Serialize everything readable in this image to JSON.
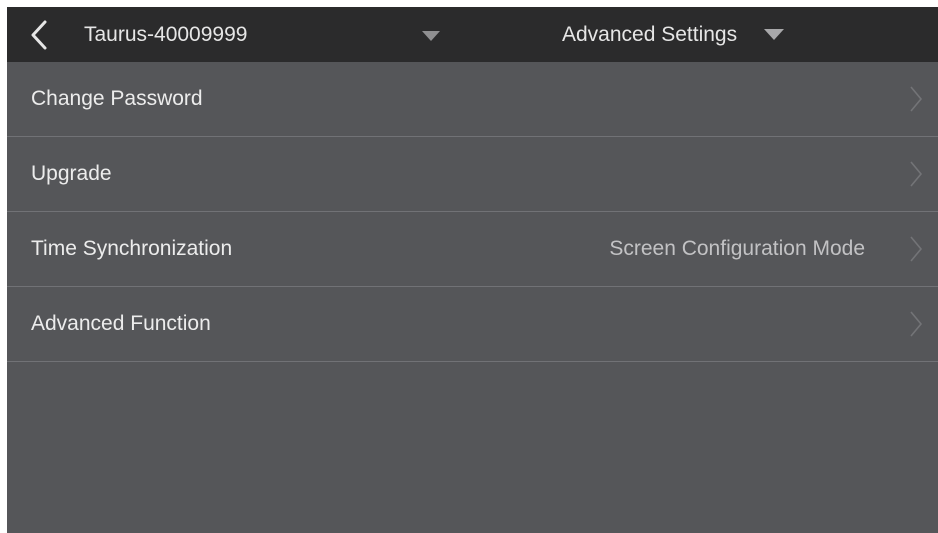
{
  "topbar": {
    "back_icon": "chevron-left-icon",
    "device_name": "Taurus-40009999",
    "device_dropdown_icon": "caret-down-icon",
    "title": "Advanced Settings",
    "title_dropdown_icon": "caret-down-icon"
  },
  "menu": {
    "items": [
      {
        "label": "Change Password",
        "value": "",
        "icon": "chevron-right-icon"
      },
      {
        "label": "Upgrade",
        "value": "",
        "icon": "chevron-right-icon"
      },
      {
        "label": "Time Synchronization",
        "value": "Screen Configuration Mode",
        "icon": "chevron-right-icon"
      },
      {
        "label": "Advanced Function",
        "value": "",
        "icon": "chevron-right-icon"
      }
    ]
  },
  "colors": {
    "topbar_bg": "#2b2b2c",
    "content_bg": "#555659",
    "divider": "#717276",
    "text": "#ececec",
    "secondary_text": "#c2c2c4"
  }
}
